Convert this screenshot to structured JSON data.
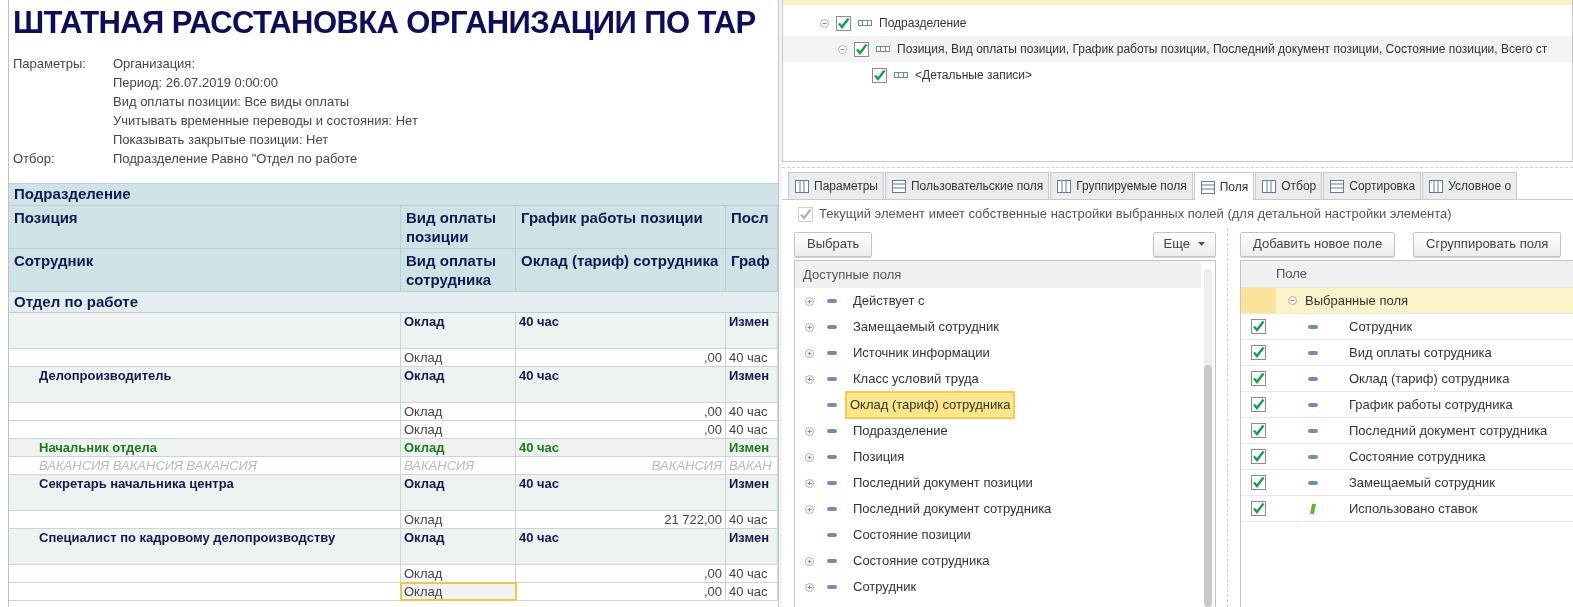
{
  "report": {
    "title": "ШТАТНАЯ РАССТАНОВКА ОРГАНИЗАЦИИ ПО ТАР",
    "parameters": [
      {
        "label": "Параметры:",
        "value": "Организация:"
      },
      {
        "value": "Период: 26.07.2019 0:00:00"
      },
      {
        "value": "Вид оплаты позиции: Все виды оплаты"
      },
      {
        "value": "Учитывать временные переводы и состояния: Нет"
      },
      {
        "value": "Показывать закрытые позиции: Нет"
      },
      {
        "label": "Отбор:",
        "value": "Подразделение Равно \"Отдел по работе"
      }
    ],
    "group_header": "Подразделение",
    "header_rows": [
      [
        "Позиция",
        "Вид оплаты позиции",
        "График работы позиции",
        "Посл"
      ],
      [
        "Сотрудник",
        "Вид оплаты сотрудника",
        "Оклад (тариф) сотрудника",
        "Граф"
      ]
    ],
    "group": "Отдел по работе",
    "rows": [
      {
        "kind": "position",
        "cells": [
          "",
          "Оклад",
          "40 час",
          "Измен"
        ]
      },
      {
        "kind": "employee",
        "selected": false,
        "cells": [
          "",
          "Оклад",
          ",00",
          "40 час"
        ]
      },
      {
        "kind": "position",
        "cells": [
          "Делопроизводитель",
          "Оклад",
          "40 час",
          "Измен"
        ]
      },
      {
        "kind": "employee",
        "selected": false,
        "cells": [
          "",
          "Оклад",
          ",00",
          "40 час"
        ]
      },
      {
        "kind": "employee",
        "selected": false,
        "cells": [
          "",
          "Оклад",
          ",00",
          "40 час"
        ]
      },
      {
        "kind": "vacant_position",
        "cells": [
          "Начальник отдела",
          "Оклад",
          "40 час",
          "Измен"
        ]
      },
      {
        "kind": "vacancy",
        "cells": [
          "ВАКАНСИЯ ВАКАНСИЯ ВАКАНСИЯ",
          "ВАКАНСИЯ",
          "ВАКАНСИЯ",
          "ВАКАН"
        ]
      },
      {
        "kind": "position",
        "cells": [
          "Секретарь начальника центра",
          "Оклад",
          "40 час",
          "Измен"
        ]
      },
      {
        "kind": "employee",
        "selected": false,
        "cells": [
          "",
          "Оклад",
          "21 722,00",
          "40 час"
        ]
      },
      {
        "kind": "position",
        "cells": [
          "Специалист по кадровому делопроизводству",
          "Оклад",
          "40 час",
          "Измен"
        ]
      },
      {
        "kind": "employee",
        "selected": false,
        "cells": [
          "",
          "Оклад",
          ",00",
          "40 час"
        ]
      },
      {
        "kind": "employee",
        "selected": true,
        "cells": [
          "",
          "Оклад",
          ",00",
          "40 час"
        ]
      }
    ]
  },
  "structure": [
    {
      "label": "Подразделение",
      "checked": true,
      "expanded": true,
      "children": [
        {
          "label": "Позиция, Вид оплаты позиции, График работы позиции, Последний документ позиции, Состояние позиции, Всего ст",
          "checked": true,
          "expanded": true,
          "children": [
            {
              "label": "<Детальные записи>",
              "checked": true
            }
          ]
        }
      ]
    }
  ],
  "tabs": [
    {
      "label": "Параметры",
      "selected": false
    },
    {
      "label": "Пользовательские поля",
      "selected": false
    },
    {
      "label": "Группируемые поля",
      "selected": false
    },
    {
      "label": "Поля",
      "selected": true
    },
    {
      "label": "Отбор",
      "selected": false
    },
    {
      "label": "Сортировка",
      "selected": false
    },
    {
      "label": "Условное о",
      "selected": false
    }
  ],
  "own_settings": {
    "label": "Текущий элемент имеет собственные настройки выбранных полей (для детальной настройки элемента)",
    "checked": true,
    "disabled": true
  },
  "available": {
    "buttons": [
      "Выбрать"
    ],
    "more_button": "Еще",
    "header": "Доступные поля",
    "items": [
      {
        "label": "Действует с",
        "expandable": true,
        "selected": false
      },
      {
        "label": "Замещаемый сотрудник",
        "expandable": true,
        "selected": false
      },
      {
        "label": "Источник информации",
        "expandable": true,
        "selected": false
      },
      {
        "label": "Класс условий труда",
        "expandable": true,
        "selected": false
      },
      {
        "label": "Оклад (тариф) сотрудника",
        "expandable": false,
        "selected": true
      },
      {
        "label": "Подразделение",
        "expandable": true,
        "selected": false
      },
      {
        "label": "Позиция",
        "expandable": true,
        "selected": false
      },
      {
        "label": "Последний документ позиции",
        "expandable": true,
        "selected": false
      },
      {
        "label": "Последний документ сотрудника",
        "expandable": true,
        "selected": false
      },
      {
        "label": "Состояние позиции",
        "expandable": false,
        "selected": false
      },
      {
        "label": "Состояние сотрудника",
        "expandable": true,
        "selected": false
      },
      {
        "label": "Сотрудник",
        "expandable": true,
        "selected": false
      }
    ]
  },
  "selected_fields": {
    "buttons": [
      "Добавить новое поле",
      "Сгруппировать поля"
    ],
    "header": "Поле",
    "group": "Выбранные поля",
    "items": [
      {
        "label": "Сотрудник",
        "checked": true,
        "kind": "field"
      },
      {
        "label": "Вид оплаты сотрудника",
        "checked": true,
        "kind": "field"
      },
      {
        "label": "Оклад (тариф) сотрудника",
        "checked": true,
        "kind": "field"
      },
      {
        "label": "График работы сотрудника",
        "checked": true,
        "kind": "field"
      },
      {
        "label": "Последний документ сотрудника",
        "checked": true,
        "kind": "field"
      },
      {
        "label": "Состояние сотрудника",
        "checked": true,
        "kind": "field"
      },
      {
        "label": "Замещаемый сотрудник",
        "checked": true,
        "kind": "field"
      },
      {
        "label": "Использовано ставок",
        "checked": true,
        "kind": "resource"
      }
    ]
  }
}
